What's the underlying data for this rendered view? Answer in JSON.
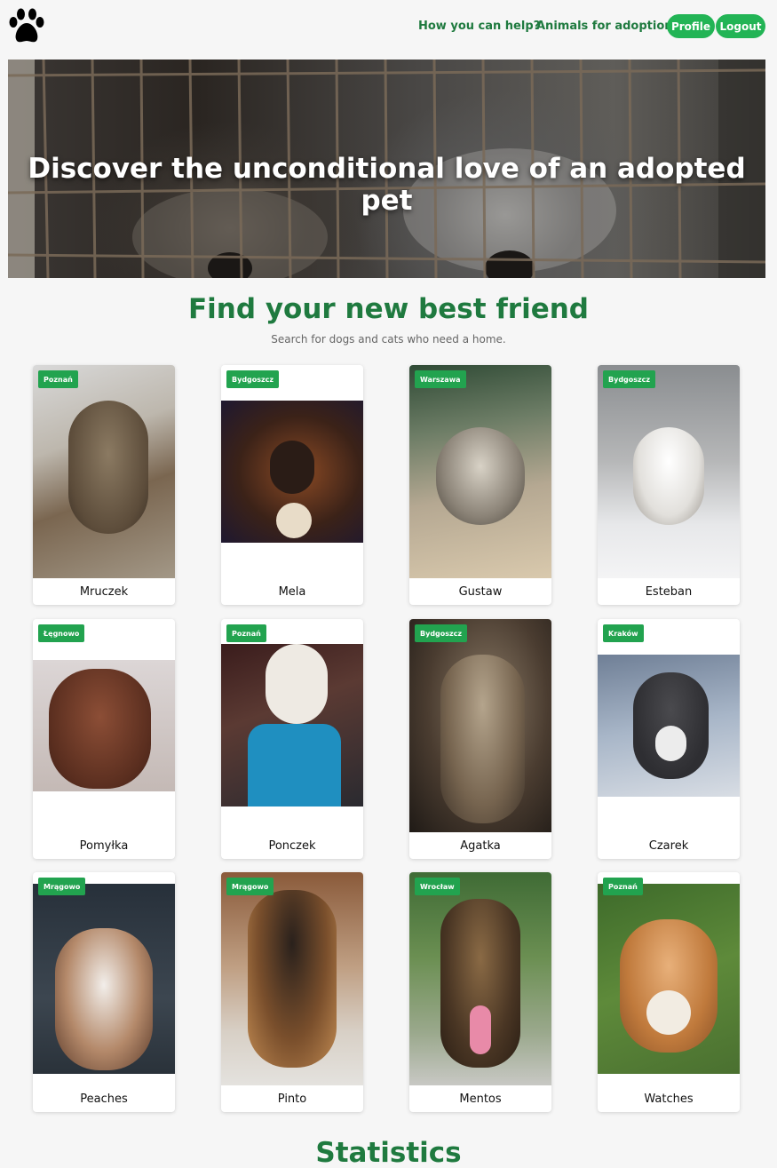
{
  "header": {
    "logo_icon": "paw-icon",
    "nav_help": "How you can help?",
    "nav_animals": "Animals for adoption",
    "profile_label": "Profile",
    "logout_label": "Logout",
    "accent": "#22b455",
    "link_color": "#1f7a3f"
  },
  "hero": {
    "title": "Discover the unconditional love of an adopted pet"
  },
  "find": {
    "title": "Find your new best friend",
    "subtitle": "Search for dogs and cats who need a home."
  },
  "pets": [
    {
      "name": "Mruczek",
      "city": "Poznań"
    },
    {
      "name": "Mela",
      "city": "Bydgoszcz"
    },
    {
      "name": "Gustaw",
      "city": "Warszawa"
    },
    {
      "name": "Esteban",
      "city": "Bydgoszcz"
    },
    {
      "name": "Pomyłka",
      "city": "Łęgnowo"
    },
    {
      "name": "Ponczek",
      "city": "Poznań"
    },
    {
      "name": "Agatka",
      "city": "Bydgoszcz"
    },
    {
      "name": "Czarek",
      "city": "Kraków"
    },
    {
      "name": "Peaches",
      "city": "Mrągowo"
    },
    {
      "name": "Pinto",
      "city": "Mrągowo"
    },
    {
      "name": "Mentos",
      "city": "Wrocław"
    },
    {
      "name": "Watches",
      "city": "Poznań"
    }
  ],
  "statistics": {
    "title": "Statistics"
  }
}
